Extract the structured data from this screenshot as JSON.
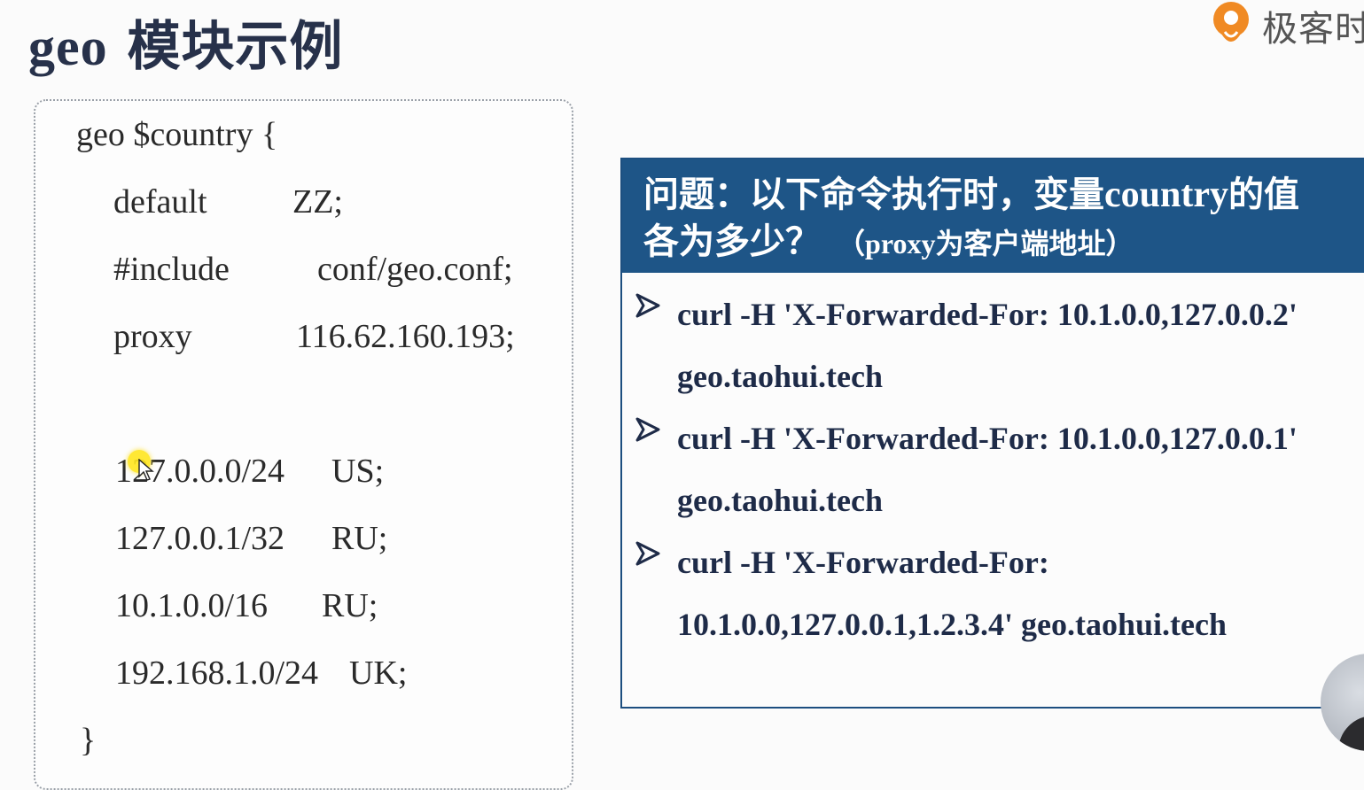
{
  "slide": {
    "title_latin": "geo",
    "title_cn": "模块示例",
    "logo_text": "极客时"
  },
  "code": {
    "lines": [
      {
        "a": "geo $country {",
        "b": ""
      },
      {
        "a": "default",
        "b": "ZZ;"
      },
      {
        "a": "#include",
        "b": "conf/geo.conf;"
      },
      {
        "a": "proxy",
        "b": "116.62.160.193;"
      },
      {
        "a": "127.0.0.0/24",
        "b": "US;"
      },
      {
        "a": "127.0.0.1/32",
        "b": "RU;"
      },
      {
        "a": "10.1.0.0/16",
        "b": "RU;"
      },
      {
        "a": "192.168.1.0/24",
        "b": "UK;"
      },
      {
        "a": "}",
        "b": ""
      }
    ]
  },
  "question": {
    "line1_cn_a": "问题：以下命令执行时，变量",
    "line1_latin": "country",
    "line1_cn_b": "的值",
    "line2_cn": "各为多少？",
    "note_open": "（",
    "note_latin": "proxy",
    "note_cn": "为客户端地址）",
    "commands": [
      {
        "line1": "curl -H 'X-Forwarded-For: 10.1.0.0,127.0.0.2'",
        "line2": "geo.taohui.tech"
      },
      {
        "line1": "curl -H 'X-Forwarded-For: 10.1.0.0,127.0.0.1'",
        "line2": "geo.taohui.tech"
      },
      {
        "line1": "curl -H 'X-Forwarded-For:",
        "line2": "10.1.0.0,127.0.0.1,1.2.3.4' geo.taohui.tech"
      }
    ]
  },
  "colors": {
    "header_bg": "#1e5587",
    "title": "#27314a",
    "logo_orange": "#f08a24"
  }
}
